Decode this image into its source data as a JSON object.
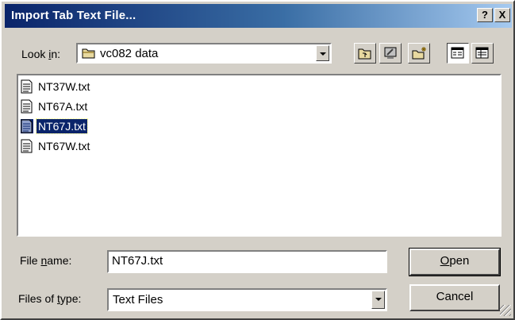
{
  "window": {
    "title": "Import Tab Text File...",
    "help_label": "?",
    "close_label": "X"
  },
  "look_in": {
    "label_pre": "Look ",
    "label_key": "i",
    "label_post": "n:",
    "value": "vc082 data"
  },
  "toolbar": {
    "icons": [
      "up-folder-icon",
      "desktop-icon",
      "new-folder-icon",
      "list-view-icon",
      "details-view-icon"
    ]
  },
  "files": [
    {
      "name": "NT37W.txt",
      "selected": false
    },
    {
      "name": "NT67A.txt",
      "selected": false
    },
    {
      "name": "NT67J.txt",
      "selected": true
    },
    {
      "name": "NT67W.txt",
      "selected": false
    }
  ],
  "file_name": {
    "label_pre": "File ",
    "label_key": "n",
    "label_post": "ame:",
    "value": "NT67J.txt"
  },
  "file_type": {
    "label_pre": "Files of ",
    "label_key": "t",
    "label_post": "ype:",
    "value": "Text Files"
  },
  "buttons": {
    "open_key": "O",
    "open_rest": "pen",
    "cancel": "Cancel"
  },
  "colors": {
    "title_start": "#0a246a",
    "title_end": "#a6caf0",
    "face": "#d4d0c8",
    "selection": "#0a246a"
  }
}
